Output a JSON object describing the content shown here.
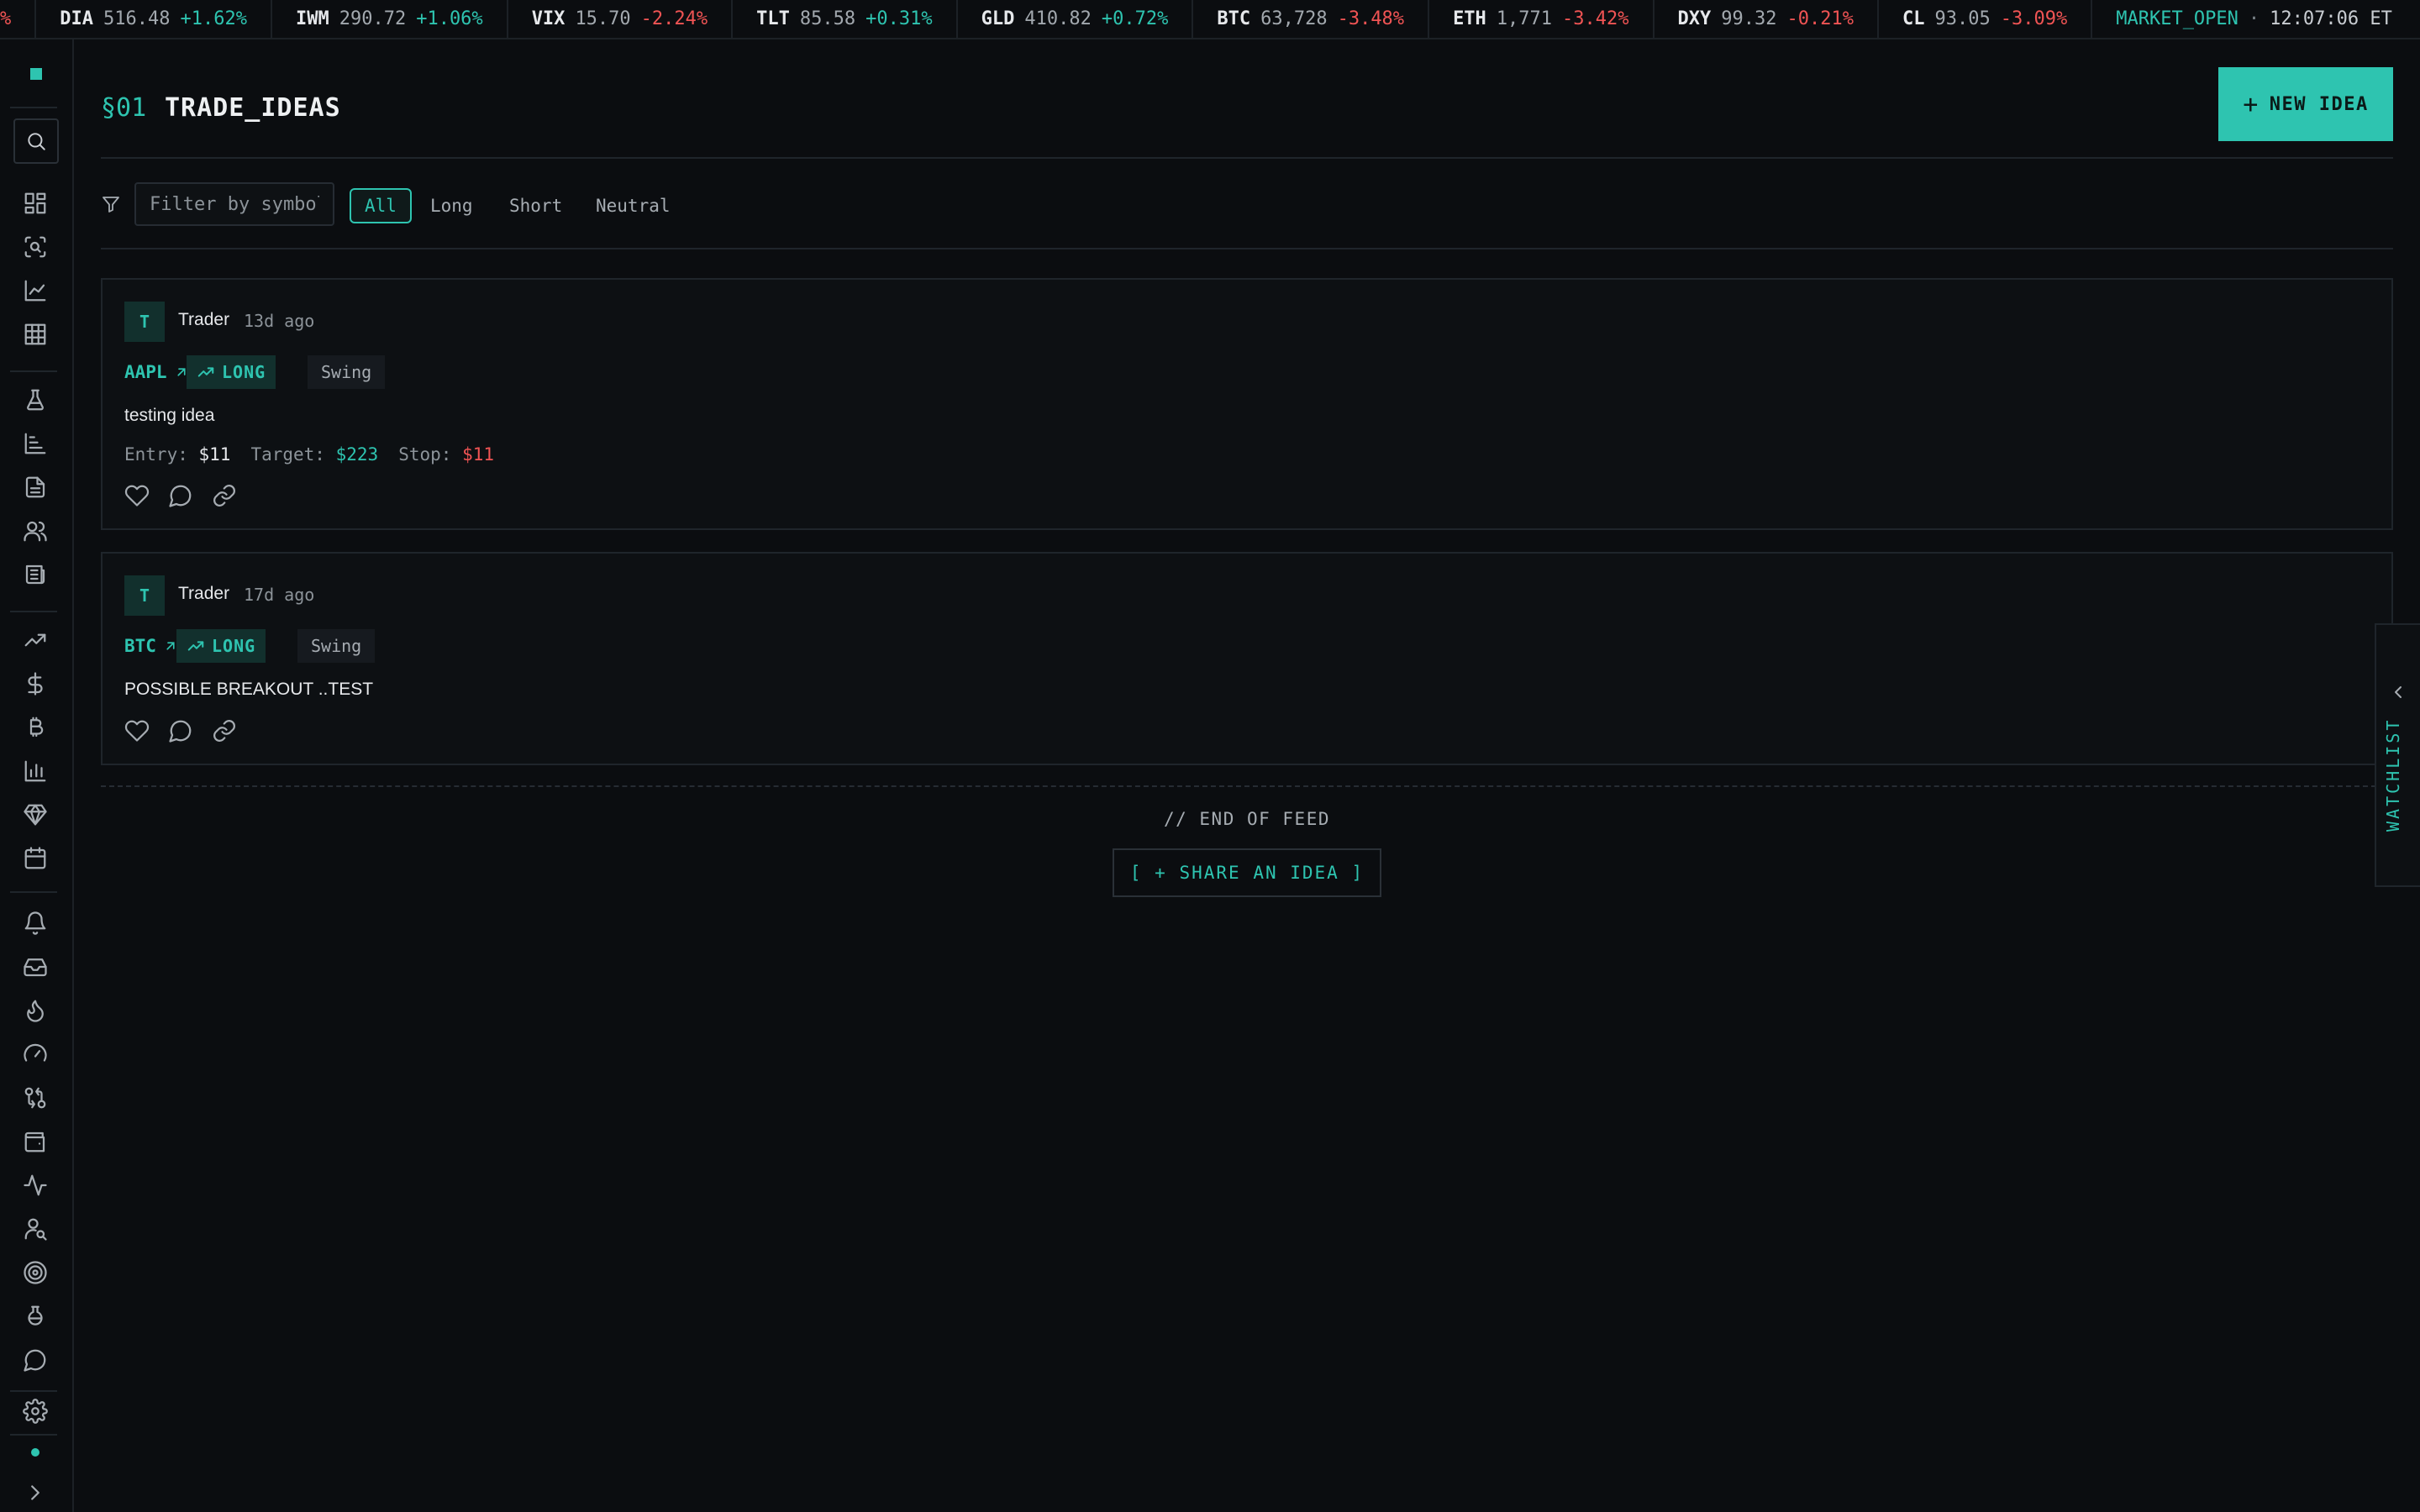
{
  "ticker": {
    "lead_fragment": "%",
    "items": [
      {
        "symbol": "DIA",
        "price": "516.48",
        "change": "+1.62%",
        "dir": "up"
      },
      {
        "symbol": "IWM",
        "price": "290.72",
        "change": "+1.06%",
        "dir": "up"
      },
      {
        "symbol": "VIX",
        "price": "15.70",
        "change": "-2.24%",
        "dir": "down"
      },
      {
        "symbol": "TLT",
        "price": "85.58",
        "change": "+0.31%",
        "dir": "up"
      },
      {
        "symbol": "GLD",
        "price": "410.82",
        "change": "+0.72%",
        "dir": "up"
      },
      {
        "symbol": "BTC",
        "price": "63,728",
        "change": "-3.48%",
        "dir": "down"
      },
      {
        "symbol": "ETH",
        "price": "1,771",
        "change": "-3.42%",
        "dir": "down"
      },
      {
        "symbol": "DXY",
        "price": "99.32",
        "change": "-0.21%",
        "dir": "down"
      },
      {
        "symbol": "CL",
        "price": "93.05",
        "change": "-3.09%",
        "dir": "down"
      }
    ],
    "market_status": "MARKET_OPEN",
    "separator": "·",
    "clock": "12:07:06 ET"
  },
  "sidebar": {
    "icons": [
      "search-icon",
      "dashboard-icon",
      "scan-icon",
      "line-chart-icon",
      "grid-icon",
      "flask-icon",
      "bar-chart-icon",
      "document-icon",
      "users-icon",
      "newspaper-icon",
      "trending-up-icon",
      "dollar-icon",
      "bitcoin-icon",
      "column-chart-icon",
      "gem-icon",
      "calendar-icon",
      "bell-icon",
      "inbox-icon",
      "flame-icon",
      "gauge-icon",
      "swap-icon",
      "wallet-icon",
      "activity-icon",
      "user-search-icon",
      "target-icon",
      "beaker-icon",
      "chat-icon",
      "gear-icon",
      "chevron-right-icon"
    ]
  },
  "header": {
    "section_num": "§01",
    "title": "TRADE_IDEAS",
    "new_idea_plus": "+",
    "new_idea_label": "NEW IDEA"
  },
  "filters": {
    "placeholder": "Filter by symbol",
    "chips": [
      {
        "label": "All",
        "active": true
      },
      {
        "label": "Long",
        "active": false
      },
      {
        "label": "Short",
        "active": false
      },
      {
        "label": "Neutral",
        "active": false
      }
    ]
  },
  "ideas": [
    {
      "avatar": "T",
      "author": "Trader",
      "ago": "13d ago",
      "symbol": "AAPL",
      "direction": "LONG",
      "timeframe": "Swing",
      "text": "testing idea",
      "entry_label": "Entry:",
      "entry": "$11",
      "target_label": "Target:",
      "target": "$223",
      "stop_label": "Stop:",
      "stop": "$11"
    },
    {
      "avatar": "T",
      "author": "Trader",
      "ago": "17d ago",
      "symbol": "BTC",
      "direction": "LONG",
      "timeframe": "Swing",
      "text": "POSSIBLE BREAKOUT ..TEST"
    }
  ],
  "feed": {
    "end_label": "// END OF FEED",
    "share_label": "[ + SHARE AN IDEA ]"
  },
  "watchlist": {
    "label": "WATCHLIST"
  },
  "colors": {
    "accent": "#2ec4b0",
    "negative": "#f05454",
    "background": "#0b0d10"
  }
}
